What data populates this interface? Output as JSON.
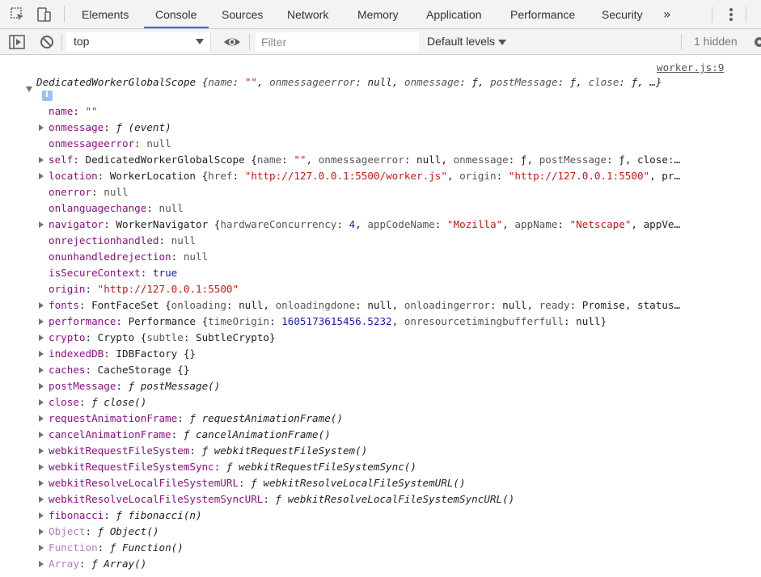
{
  "tabs": {
    "items": [
      "Elements",
      "Console",
      "Sources",
      "Network",
      "Memory",
      "Application",
      "Performance",
      "Security"
    ],
    "active": "Console",
    "more": "»"
  },
  "toolbar": {
    "context": "top",
    "filter_placeholder": "Filter",
    "levels": "Default levels",
    "hidden": "1 hidden"
  },
  "console": {
    "source": "worker.js:9",
    "header": "DedicatedWorkerGlobalScope {name: \"\", onmessageerror: null, onmessage: ƒ, postMessage: ƒ, close: ƒ, …}",
    "props": [
      {
        "key": "name",
        "expand": false,
        "val": "\"\"",
        "type": "str"
      },
      {
        "key": "onmessage",
        "expand": true,
        "val": "ƒ (event)",
        "type": "fn"
      },
      {
        "key": "onmessageerror",
        "expand": false,
        "val": "null",
        "type": "plain"
      },
      {
        "key": "self",
        "expand": true,
        "val": "DedicatedWorkerGlobalScope {name: \"\", onmessageerror: null, onmessage: ƒ, postMessage: ƒ, close:…",
        "type": "plain"
      },
      {
        "key": "location",
        "expand": true,
        "val": "WorkerLocation {href: \"http://127.0.0.1:5500/worker.js\", origin: \"http://127.0.0.1:5500\", pr…",
        "type": "plain"
      },
      {
        "key": "onerror",
        "expand": false,
        "val": "null",
        "type": "plain"
      },
      {
        "key": "onlanguagechange",
        "expand": false,
        "val": "null",
        "type": "plain"
      },
      {
        "key": "navigator",
        "expand": true,
        "val": "WorkerNavigator {hardwareConcurrency: 4, appCodeName: \"Mozilla\", appName: \"Netscape\", appVe…",
        "type": "plain"
      },
      {
        "key": "onrejectionhandled",
        "expand": false,
        "val": "null",
        "type": "plain"
      },
      {
        "key": "onunhandledrejection",
        "expand": false,
        "val": "null",
        "type": "plain"
      },
      {
        "key": "isSecureContext",
        "expand": false,
        "val": "true",
        "type": "num"
      },
      {
        "key": "origin",
        "expand": false,
        "val": "\"http://127.0.0.1:5500\"",
        "type": "str"
      },
      {
        "key": "fonts",
        "expand": true,
        "val": "FontFaceSet {onloading: null, onloadingdone: null, onloadingerror: null, ready: Promise, status…",
        "type": "plain"
      },
      {
        "key": "performance",
        "expand": true,
        "val": "Performance {timeOrigin: 1605173615456.5232, onresourcetimingbufferfull: null}",
        "type": "plain"
      },
      {
        "key": "crypto",
        "expand": true,
        "val": "Crypto {subtle: SubtleCrypto}",
        "type": "plain"
      },
      {
        "key": "indexedDB",
        "expand": true,
        "val": "IDBFactory {}",
        "type": "plain"
      },
      {
        "key": "caches",
        "expand": true,
        "val": "CacheStorage {}",
        "type": "plain"
      },
      {
        "key": "postMessage",
        "expand": true,
        "val": "ƒ postMessage()",
        "type": "fn"
      },
      {
        "key": "close",
        "expand": true,
        "val": "ƒ close()",
        "type": "fn"
      },
      {
        "key": "requestAnimationFrame",
        "expand": true,
        "val": "ƒ requestAnimationFrame()",
        "type": "fn"
      },
      {
        "key": "cancelAnimationFrame",
        "expand": true,
        "val": "ƒ cancelAnimationFrame()",
        "type": "fn"
      },
      {
        "key": "webkitRequestFileSystem",
        "expand": true,
        "val": "ƒ webkitRequestFileSystem()",
        "type": "fn"
      },
      {
        "key": "webkitRequestFileSystemSync",
        "expand": true,
        "val": "ƒ webkitRequestFileSystemSync()",
        "type": "fn"
      },
      {
        "key": "webkitResolveLocalFileSystemURL",
        "expand": true,
        "val": "ƒ webkitResolveLocalFileSystemURL()",
        "type": "fn"
      },
      {
        "key": "webkitResolveLocalFileSystemSyncURL",
        "expand": true,
        "val": "ƒ webkitResolveLocalFileSystemSyncURL()",
        "type": "fn"
      },
      {
        "key": "fibonacci",
        "expand": true,
        "val": "ƒ fibonacci(n)",
        "type": "fn"
      },
      {
        "key": "Object",
        "expand": true,
        "val": "ƒ Object()",
        "type": "fn",
        "proto": true
      },
      {
        "key": "Function",
        "expand": true,
        "val": "ƒ Function()",
        "type": "fn",
        "proto": true
      },
      {
        "key": "Array",
        "expand": true,
        "val": "ƒ Array()",
        "type": "fn",
        "proto": true
      }
    ]
  }
}
